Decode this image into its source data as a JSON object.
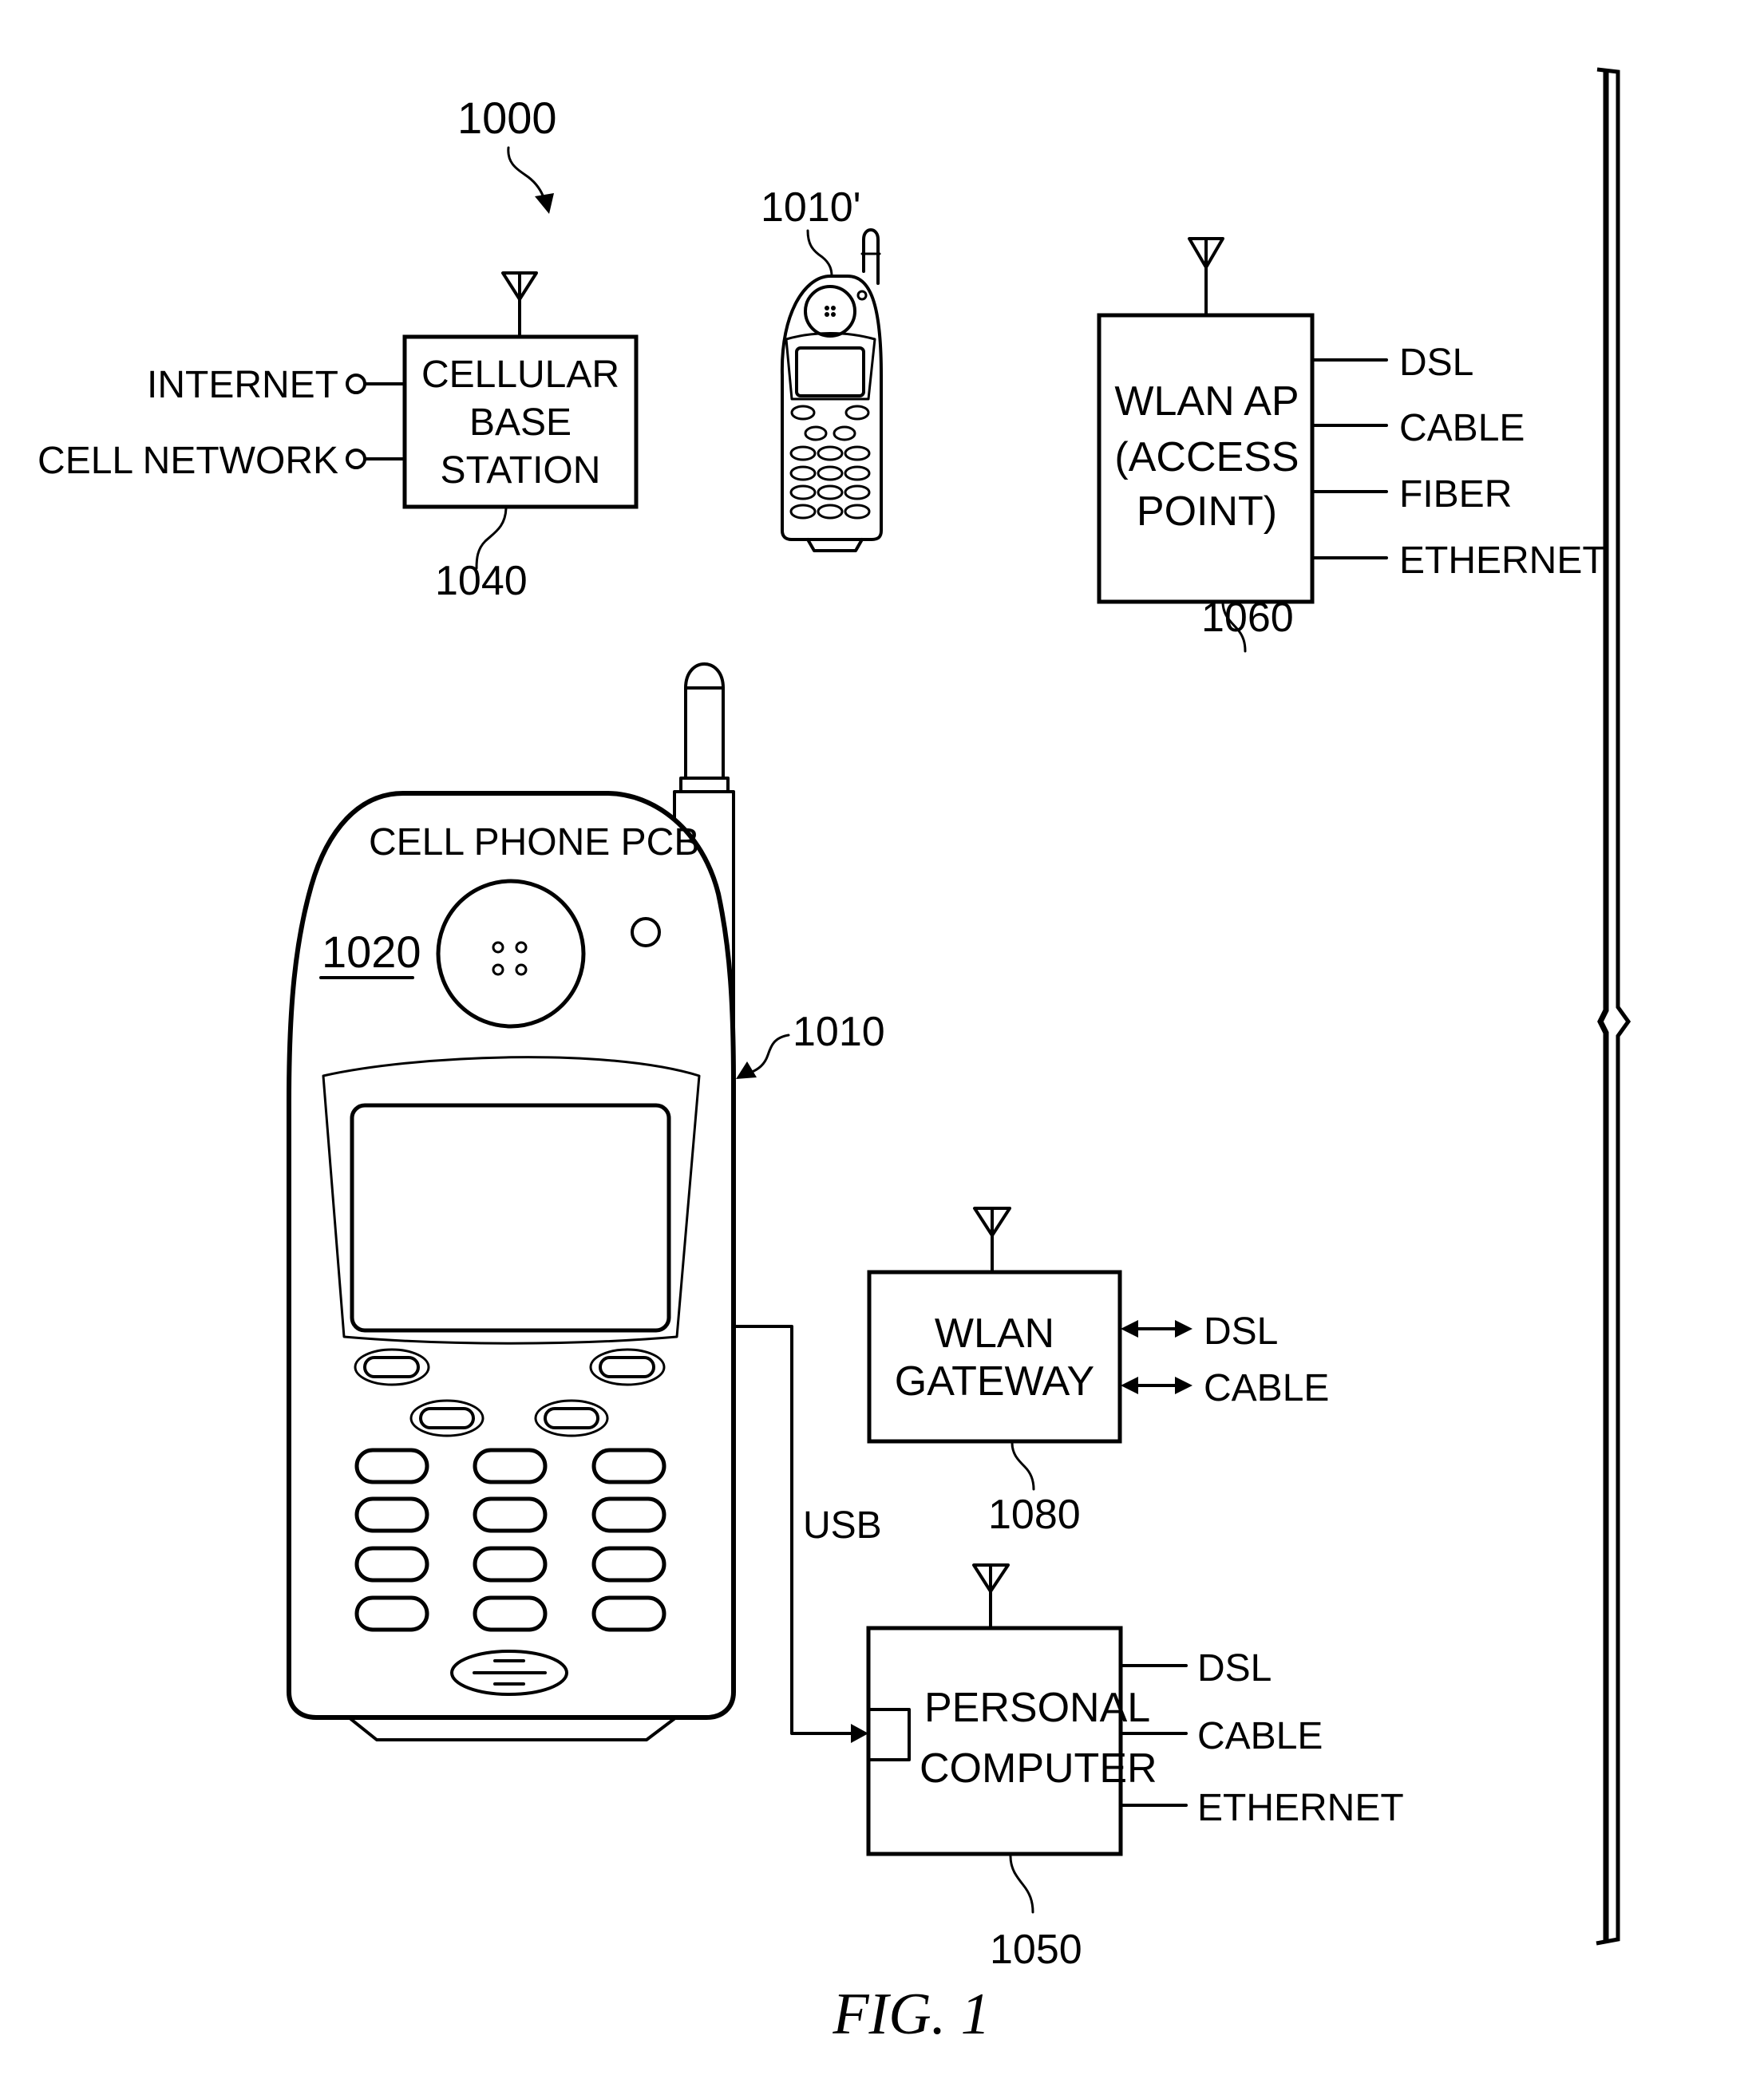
{
  "figure": {
    "caption": "FIG. 1",
    "system_ref": "1000"
  },
  "base_station": {
    "ref": "1040",
    "lines": [
      "CELLULAR",
      "BASE",
      "STATION"
    ],
    "inputs": [
      "INTERNET",
      "CELL NETWORK"
    ]
  },
  "small_phone": {
    "ref": "1010'"
  },
  "wlan_ap": {
    "ref": "1060",
    "lines": [
      "WLAN AP",
      "(ACCESS",
      "POINT)"
    ],
    "connections": [
      "DSL",
      "CABLE",
      "FIBER",
      "ETHERNET"
    ]
  },
  "cell_phone": {
    "ref": "1010",
    "pcb_label": "CELL PHONE PCB",
    "pcb_ref": "1020"
  },
  "wlan_gateway": {
    "ref": "1080",
    "lines": [
      "WLAN",
      "GATEWAY"
    ],
    "connections": [
      "DSL",
      "CABLE"
    ]
  },
  "usb_link": {
    "label": "USB"
  },
  "personal_computer": {
    "ref": "1050",
    "lines": [
      "PERSONAL",
      "COMPUTER"
    ],
    "connections": [
      "DSL",
      "CABLE",
      "ETHERNET"
    ]
  }
}
